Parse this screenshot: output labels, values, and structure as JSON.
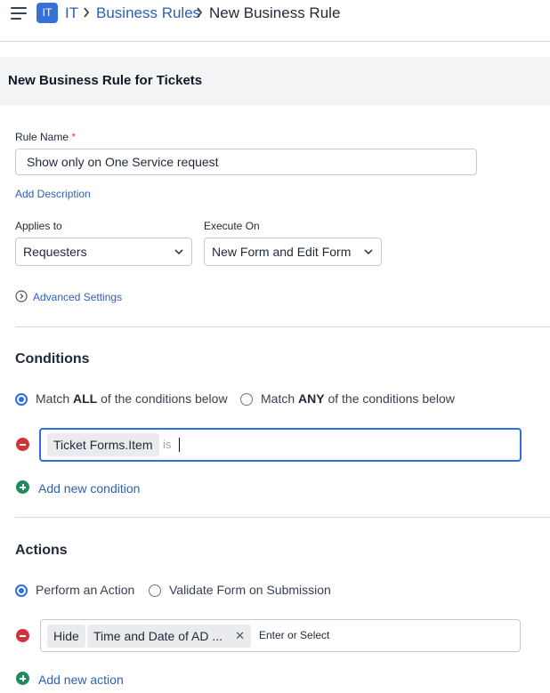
{
  "header": {
    "menu_icon": "hamburger-menu-icon",
    "workspace_badge": "IT",
    "breadcrumb": {
      "root": "IT",
      "parent": "Business Rules",
      "current": "New Business Rule"
    }
  },
  "page": {
    "title": "New Business Rule for Tickets"
  },
  "form": {
    "rule_name_label": "Rule Name",
    "required_mark": "*",
    "rule_name_value": "Show only on One Service request",
    "add_description": "Add Description",
    "applies_to_label": "Applies to",
    "applies_to_value": "Requesters",
    "execute_on_label": "Execute On",
    "execute_on_value": "New Form and Edit Form",
    "advanced_settings": "Advanced Settings"
  },
  "conditions": {
    "title": "Conditions",
    "match_all": {
      "prefix": "Match ",
      "bold": "ALL",
      "suffix": " of the conditions below",
      "selected": true
    },
    "match_any": {
      "prefix": "Match ",
      "bold": "ANY",
      "suffix": " of the conditions below",
      "selected": false
    },
    "row": {
      "field": "Ticket Forms.Item",
      "operator": "is"
    },
    "add_label": "Add new condition"
  },
  "actions": {
    "title": "Actions",
    "perform": {
      "label": "Perform an Action",
      "selected": true
    },
    "validate": {
      "label": "Validate Form on Submission",
      "selected": false
    },
    "row": {
      "action": "Hide",
      "field": "Time and Date of AD ...",
      "placeholder": "Enter or Select"
    },
    "add_label": "Add new action"
  },
  "colors": {
    "accent": "#2f6fe0",
    "link": "#2f5fb3",
    "danger": "#d13438",
    "success": "#1f8a5b"
  }
}
